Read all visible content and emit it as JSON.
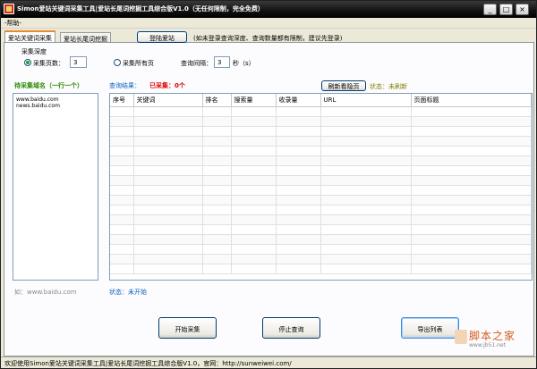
{
  "window": {
    "title": "Simon爱站关键词采集工具|爱站长尾词挖掘工具综合版V1.0（无任何限制，完全免费）",
    "minimize": "_",
    "maximize": "□",
    "close": "×"
  },
  "menu": {
    "help": "-帮助-"
  },
  "tabs": [
    {
      "label": "爱站关键词采集"
    },
    {
      "label": "爱站长尾词挖掘"
    }
  ],
  "toolbar": {
    "login_button": "登陆爱站",
    "login_hint": "(如未登录查询深度、查询数量都有限制，建议先登录)"
  },
  "depth": {
    "label": "采集深度",
    "pages_option": "采集页数：",
    "pages_value": "3",
    "all_pages_option": "采集所有页",
    "all_pages_selected": false,
    "interval_label": "查询间隔：",
    "interval_value": "3",
    "interval_unit": "秒（s）"
  },
  "domains": {
    "label": "待采集域名（一行一个）",
    "lines": [
      "www.baidu.com",
      "news.baidu.com"
    ],
    "example": "如：www.baidu.com"
  },
  "results": {
    "label": "查询结果：",
    "collected": "已采集：0个",
    "refresh_button": "刷新看隐页",
    "status": "状态：未刷新",
    "columns": [
      "序号",
      "关键词",
      "排名",
      "搜索量",
      "收录量",
      "URL",
      "页面标题"
    ]
  },
  "collect_status": "状态：未开始",
  "actions": {
    "start": "开始采集",
    "stop": "停止查询",
    "export": "导出列表"
  },
  "statusbar": "欢迎使用Simon爱站关键词采集工具|爱站长尾词挖掘工具综合版V1.0，官网：http://sunweiwei.com/",
  "watermark": {
    "text": "脚本之家",
    "url": "www.jb51.net"
  }
}
